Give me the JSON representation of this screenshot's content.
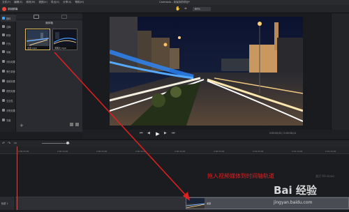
{
  "menubar": {
    "items": [
      "文件(F)",
      "编辑(E)",
      "修改(M)",
      "视图(V)",
      "导出(S)",
      "分享(S)",
      "帮助(H)"
    ],
    "title": "Camtasia - 未保存的项目*"
  },
  "toolbar": {
    "record_label": "录制屏幕",
    "zoom": "69%"
  },
  "tools": [
    "媒体",
    "注释",
    "转场",
    "行为",
    "动画",
    "光标效果",
    "旁白录音",
    "音频效果",
    "视觉效果",
    "交互性",
    "手势效果",
    "字幕"
  ],
  "media_bin": {
    "title": "媒体箱",
    "items": [
      {
        "caption": "北京.mp4"
      },
      {
        "caption": "河南大.mp4"
      }
    ],
    "add_icon": "+"
  },
  "transport": {
    "timecode": "0:00:00;00 / 0:00:58;14"
  },
  "timeline": {
    "ticks": [
      "0:00:00;00",
      "0:00:10;00",
      "0:00:20;00",
      "0:00:30;00",
      "0:00:40;00",
      "0:00:50;00",
      "0:01:00;00",
      "0:01:10;00",
      "0:01:20;00"
    ],
    "track_label": "轨道 1",
    "clip_label": "北京"
  },
  "annotation": {
    "text": "拖入视频媒体到时间轴轨道",
    "color": "#e02020"
  },
  "watermark": {
    "brand": "Bai 经验",
    "url": "jingyan.baidu.com",
    "win": "激活 Windows"
  },
  "colors": {
    "accent": "#3ea6ff",
    "record": "#e8443a",
    "selected_border": "#e0c060"
  },
  "icons": {
    "play": "play-icon",
    "record": "record-dot-icon"
  }
}
